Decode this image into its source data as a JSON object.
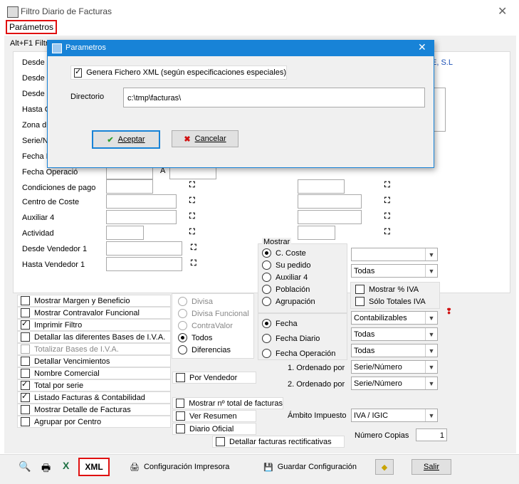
{
  "window": {
    "title": "Filtro Diario de Facturas",
    "close_glyph": "✕",
    "menu_label": "Parámetros",
    "tab_label": "Alt+F1 Filtro",
    "company_fragment": "E, S.L"
  },
  "left_filters": {
    "rows": [
      {
        "label": "Desde"
      },
      {
        "label": "Desde"
      },
      {
        "label": "Desde"
      },
      {
        "label": "Hasta C"
      },
      {
        "label": "Zona d"
      },
      {
        "label": "Serie/N"
      },
      {
        "label": "Fecha I"
      },
      {
        "label": "Fecha Operació"
      },
      {
        "label": "Condiciones de pago"
      },
      {
        "label": "Centro de Coste"
      },
      {
        "label": "Auxiliar 4"
      },
      {
        "label": "Actividad"
      },
      {
        "label": "Desde Vendedor 1"
      },
      {
        "label": "Hasta Vendedor 1"
      }
    ],
    "range_sep": "A"
  },
  "mostrar": {
    "legend": "Mostrar",
    "options": [
      "C. Coste",
      "Su pedido",
      "Auxiliar 4",
      "Población",
      "Agrupación"
    ],
    "selected": 0
  },
  "fecha_group": {
    "options": [
      "Fecha",
      "Fecha Diario",
      "Fecha Operación"
    ],
    "selected": 0
  },
  "divisa_group": {
    "options": [
      "Divisa",
      "Divisa Funcional",
      "ContraValor",
      "Todos",
      "Diferencias"
    ],
    "disabled": [
      true,
      true,
      true,
      false,
      false
    ],
    "selected": 3
  },
  "right_selects": {
    "blank": "",
    "todas1": "Todas",
    "contabilizables": "Contabilizables",
    "todas2": "Todas",
    "todas3": "Todas",
    "orden1": "Serie/Número",
    "orden2": "Serie/Número",
    "ambito": "IVA / IGIC"
  },
  "right_checks": {
    "mostrar_iva": "Mostrar % IVA",
    "solo_totales": "Sólo Totales IVA"
  },
  "labels": {
    "ordenado1": "1. Ordenado por",
    "ordenado2": "2. Ordenado por",
    "ambito": "Ámbito Impuesto",
    "copias": "Número Copias",
    "copias_value": "1"
  },
  "left_checks": [
    {
      "label": "Mostrar Margen y Beneficio",
      "checked": false,
      "disabled": false
    },
    {
      "label": "Mostrar Contravalor Funcional",
      "checked": false,
      "disabled": false
    },
    {
      "label": "Imprimir Filtro",
      "checked": true,
      "disabled": false
    },
    {
      "label": "Detallar las diferentes Bases de I.V.A.",
      "checked": false,
      "disabled": false
    },
    {
      "label": "Totalizar Bases de I.V.A.",
      "checked": false,
      "disabled": true
    },
    {
      "label": "Detallar Vencimientos",
      "checked": false,
      "disabled": false
    },
    {
      "label": "Nombre Comercial",
      "checked": false,
      "disabled": false
    },
    {
      "label": "Total por serie",
      "checked": true,
      "disabled": false
    },
    {
      "label": "Listado Facturas & Contabilidad",
      "checked": true,
      "disabled": false
    },
    {
      "label": "Mostrar Detalle de Facturas",
      "checked": false,
      "disabled": false
    },
    {
      "label": "Agrupar por Centro",
      "checked": false,
      "disabled": false
    }
  ],
  "mid_checks": {
    "por_vendedor": "Por Vendedor",
    "mostrar_total": "Mostrar nº total de facturas",
    "ver_resumen": "Ver Resumen",
    "diario_oficial": "Diario Oficial",
    "rectificativas": "Detallar facturas rectificativas"
  },
  "toolbar": {
    "xml": "XML",
    "config_impresora": "Configuración Impresora",
    "guardar_config": "Guardar Configuración",
    "salir": "Salir"
  },
  "dialog": {
    "title": "Parametros",
    "close_glyph": "✕",
    "checkbox_label": "Genera Fichero XML (según especificaciones especiales)",
    "checkbox_checked": true,
    "dir_label": "Directorio",
    "dir_value": "c:\\tmp\\facturas\\",
    "ok": "Aceptar",
    "cancel": "Cancelar"
  },
  "colors": {
    "dialog_title": "#1883d7",
    "highlight": "#e01010"
  }
}
